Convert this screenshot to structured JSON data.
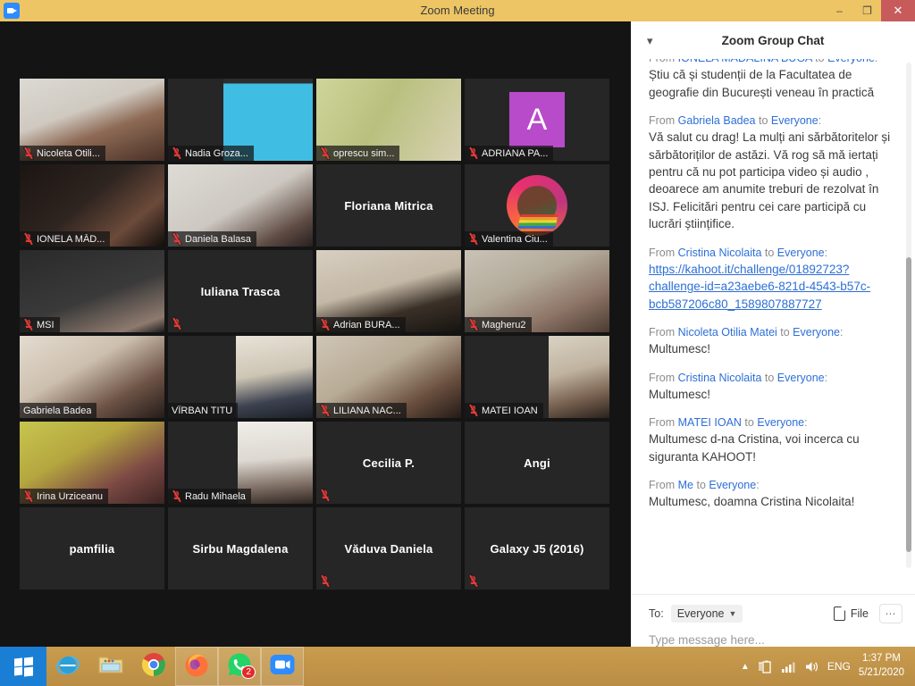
{
  "window": {
    "title": "Zoom Meeting",
    "app_icon": "zoom-camera-icon",
    "minimize": "–",
    "restore": "❐",
    "close": "✕"
  },
  "chat": {
    "header": "Zoom Group Chat",
    "collapse_icon": "chevron-down-icon",
    "messages": [
      {
        "prefix": "From ",
        "sender": "IONELA MADALINA BUGA",
        "mid": " to ",
        "target": "Everyone",
        "suffix": ":",
        "body": "Știu că și studenții de la Facultatea de geografie din București veneau în practică",
        "is_link": false
      },
      {
        "prefix": "From ",
        "sender": "Gabriela Badea",
        "mid": " to ",
        "target": "Everyone",
        "suffix": ":",
        "body": "Vă salut cu drag! La mulți ani sărbătoritelor și sărbătoriților de astăzi. Vă rog să mă iertați pentru că nu pot participa video și audio , deoarece am anumite treburi de rezolvat în ISJ. Felicitări pentru cei care participă cu lucrări științifice.",
        "is_link": false
      },
      {
        "prefix": "From ",
        "sender": "Cristina Nicolaita",
        "mid": " to ",
        "target": "Everyone",
        "suffix": ":",
        "body": "https://kahoot.it/challenge/01892723?challenge-id=a23aebe6-821d-4543-b57c-bcb587206c80_1589807887727",
        "is_link": true
      },
      {
        "prefix": "From ",
        "sender": "Nicoleta Otilia Matei",
        "mid": " to ",
        "target": "Everyone",
        "suffix": ":",
        "body": "Multumesc!",
        "is_link": false
      },
      {
        "prefix": "From ",
        "sender": "Cristina Nicolaita",
        "mid": " to ",
        "target": "Everyone",
        "suffix": ":",
        "body": "Multumesc!",
        "is_link": false
      },
      {
        "prefix": "From ",
        "sender": "MATEI IOAN",
        "mid": " to ",
        "target": "Everyone",
        "suffix": ":",
        "body": "Multumesc d-na Cristina, voi incerca cu siguranta KAHOOT!",
        "is_link": false
      },
      {
        "prefix": "From ",
        "sender": "Me",
        "mid": " to ",
        "target": "Everyone",
        "suffix": ":",
        "body": "Multumesc, doamna Cristina Nicolaita!",
        "is_link": false
      }
    ],
    "footer": {
      "to_label": "To:",
      "to_value": "Everyone",
      "to_chevron": "chevron-down-icon",
      "file_label": "File",
      "file_icon": "file-icon",
      "more_label": "⋯",
      "input_placeholder": "Type message here..."
    }
  },
  "participants": [
    {
      "name": "Nicoleta Otili...",
      "muted": true,
      "video": true,
      "style": "bg1",
      "label": "bar"
    },
    {
      "name": "Nadia Groza...",
      "muted": true,
      "video": true,
      "style": "bg2",
      "label": "bar"
    },
    {
      "name": "oprescu sim...",
      "muted": true,
      "video": true,
      "style": "bg3",
      "label": "bar"
    },
    {
      "name": "ADRIANA PA...",
      "muted": true,
      "video": false,
      "style": "avatar-letter",
      "avatar_letter": "A",
      "avatar_color": "#b84bc9",
      "label": "bar"
    },
    {
      "name": "IONELA MĂD...",
      "muted": true,
      "video": true,
      "style": "bg4",
      "label": "bar"
    },
    {
      "name": "Daniela Balasa",
      "muted": true,
      "video": true,
      "style": "bg5",
      "label": "bar"
    },
    {
      "name": "Floriana Mitrica",
      "muted": false,
      "video": false,
      "style": "none",
      "label": "center"
    },
    {
      "name": "Valentina Ciu...",
      "muted": true,
      "video": false,
      "style": "avatar-circle",
      "label": "bar"
    },
    {
      "name": "MSI",
      "muted": true,
      "video": true,
      "style": "bg6",
      "label": "bar"
    },
    {
      "name": "Iuliana Trasca",
      "muted": true,
      "video": false,
      "style": "none",
      "label": "center-mic"
    },
    {
      "name": "Adrian BURA...",
      "muted": true,
      "video": true,
      "style": "bg7",
      "label": "bar"
    },
    {
      "name": "Magheru2",
      "muted": true,
      "video": true,
      "style": "bg8",
      "label": "bar"
    },
    {
      "name": "Gabriela Badea",
      "muted": false,
      "video": true,
      "style": "bg9",
      "label": "bar"
    },
    {
      "name": "VÎRBAN TITU",
      "muted": false,
      "video": true,
      "style": "bg10",
      "label": "bar"
    },
    {
      "name": "LILIANA NAC...",
      "muted": true,
      "video": true,
      "style": "bg11",
      "label": "bar"
    },
    {
      "name": "MATEI IOAN",
      "muted": true,
      "video": true,
      "style": "bg12",
      "label": "bar"
    },
    {
      "name": "Irina Urziceanu",
      "muted": true,
      "video": true,
      "style": "bg13",
      "label": "bar"
    },
    {
      "name": "Radu Mihaela",
      "muted": true,
      "video": true,
      "style": "bg14",
      "label": "bar"
    },
    {
      "name": "Cecilia P.",
      "muted": true,
      "video": false,
      "style": "none",
      "label": "center-mic"
    },
    {
      "name": "Angi",
      "muted": false,
      "video": false,
      "style": "none",
      "label": "center"
    },
    {
      "name": "pamfilia",
      "muted": false,
      "video": false,
      "style": "none",
      "label": "center"
    },
    {
      "name": "Sirbu Magdalena",
      "muted": false,
      "video": false,
      "style": "none",
      "label": "center"
    },
    {
      "name": "Văduva Daniela",
      "muted": true,
      "video": false,
      "style": "none",
      "label": "center-mic"
    },
    {
      "name": "Galaxy J5 (2016)",
      "muted": true,
      "video": false,
      "style": "none",
      "label": "center-mic"
    }
  ],
  "taskbar": {
    "start_icon": "windows-logo-icon",
    "items": [
      {
        "icon": "internet-explorer-icon",
        "open": false,
        "badge": ""
      },
      {
        "icon": "file-explorer-icon",
        "open": false,
        "badge": ""
      },
      {
        "icon": "google-chrome-icon",
        "open": false,
        "badge": ""
      },
      {
        "icon": "firefox-icon",
        "open": true,
        "badge": ""
      },
      {
        "icon": "whatsapp-icon",
        "open": true,
        "badge": "2"
      },
      {
        "icon": "zoom-icon",
        "open": true,
        "badge": ""
      }
    ],
    "tray": {
      "show_hidden_icon": "chevron-up-icon",
      "battery_icon": "battery-icon",
      "network_icon": "signal-bars-icon",
      "volume_icon": "speaker-icon",
      "language": "ENG"
    },
    "clock": {
      "time": "1:37 PM",
      "date": "5/21/2020"
    }
  }
}
